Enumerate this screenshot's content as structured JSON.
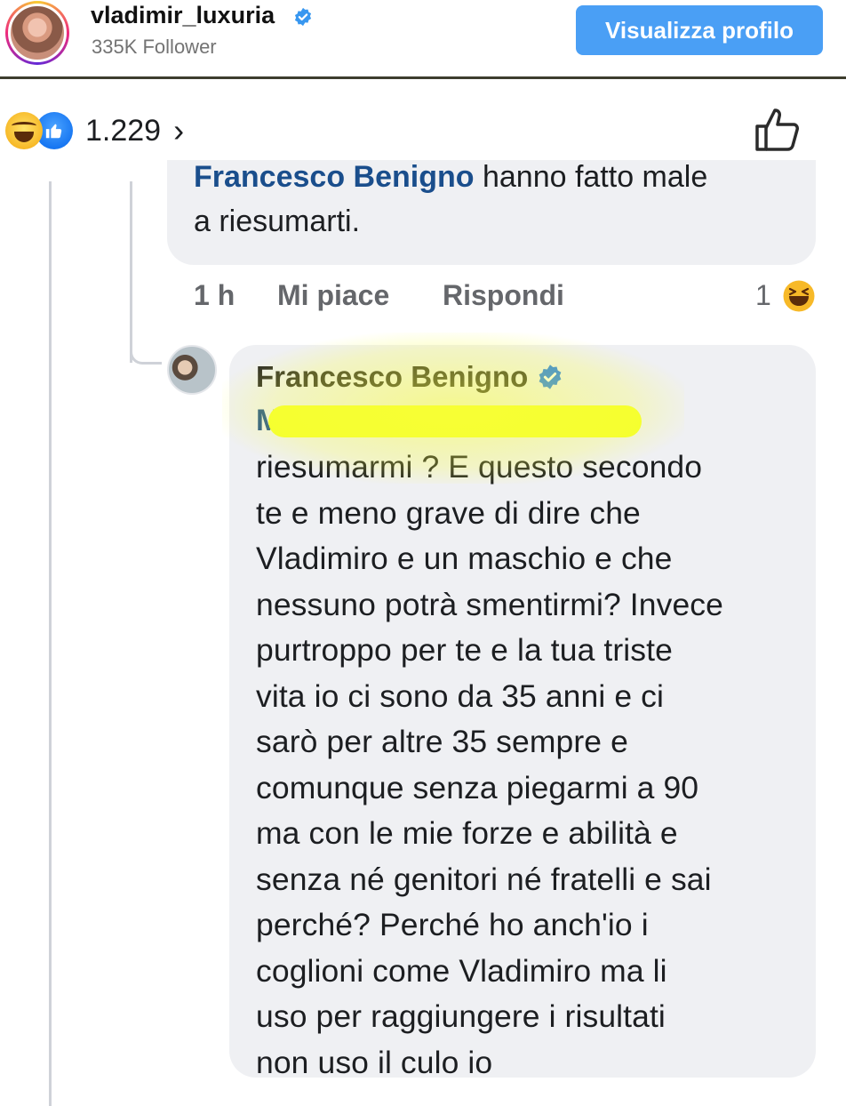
{
  "header": {
    "username": "vladimir_luxuria",
    "followers": "335K Follower",
    "profile_button": "Visualizza profilo"
  },
  "reactions": {
    "count": "1.229",
    "chevron": "›",
    "icons": [
      "haha-emoji-icon",
      "like-emoji-icon"
    ]
  },
  "previous_comment": {
    "mention": "Francesco Benigno",
    "text_line1": " hanno fatto male",
    "text_line2": "a riesumarti.",
    "time": "1 h",
    "like_label": "Mi piace",
    "reply_label": "Rispondi",
    "reaction_count": "1"
  },
  "reply": {
    "author": "Francesco Benigno",
    "mention_visible": "M",
    "body": "riesumarmi ? E questo secondo\nte e meno grave di dire che\nVladimiro e un maschio e che\nnessuno potrà smentirmi? Invece\npurtroppo per te e la tua triste\nvita io ci sono da 35 anni e ci\nsarò per altre 35 sempre e\ncomunque senza piegarmi a 90\nma con le mie forze e abilità e\nsenza né genitori né fratelli e sai\nperché? Perché ho anch'io i\ncoglioni come Vladimiro ma li\nuso per raggiungere i risultati\nnon uso il culo io"
  },
  "colors": {
    "button_blue": "#4a9ff5",
    "bubble_bg": "#eff0f3",
    "highlight_yellow": "#f4ff2c",
    "mention_blue": "#1a4e8c",
    "meta_gray": "#65676b"
  }
}
